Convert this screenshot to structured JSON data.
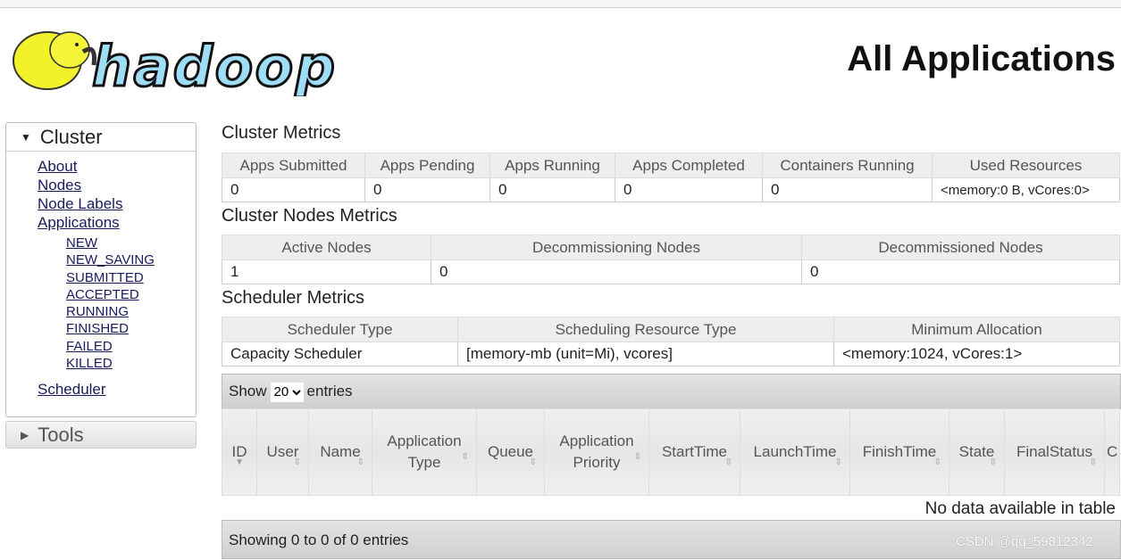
{
  "page_title": "All Applications",
  "sidebar": {
    "cluster_label": "Cluster",
    "links": [
      "About",
      "Nodes",
      "Node Labels",
      "Applications"
    ],
    "app_states": [
      "NEW",
      "NEW_SAVING",
      "SUBMITTED",
      "ACCEPTED",
      "RUNNING",
      "FINISHED",
      "FAILED",
      "KILLED"
    ],
    "scheduler_label": "Scheduler",
    "tools_label": "Tools"
  },
  "cluster_metrics": {
    "title": "Cluster Metrics",
    "headers": [
      "Apps Submitted",
      "Apps Pending",
      "Apps Running",
      "Apps Completed",
      "Containers Running",
      "Used Resources"
    ],
    "values": [
      "0",
      "0",
      "0",
      "0",
      "0",
      "<memory:0 B, vCores:0>"
    ]
  },
  "nodes_metrics": {
    "title": "Cluster Nodes Metrics",
    "headers": [
      "Active Nodes",
      "Decommissioning Nodes",
      "Decommissioned Nodes"
    ],
    "values": [
      "1",
      "0",
      "0"
    ]
  },
  "scheduler_metrics": {
    "title": "Scheduler Metrics",
    "headers": [
      "Scheduler Type",
      "Scheduling Resource Type",
      "Minimum Allocation"
    ],
    "values": [
      "Capacity Scheduler",
      "[memory-mb (unit=Mi), vcores]",
      "<memory:1024, vCores:1>"
    ]
  },
  "apps_table": {
    "show_label": "Show",
    "page_size": "20",
    "entries_label": "entries",
    "columns": [
      "ID",
      "User",
      "Name",
      "Application Type",
      "Queue",
      "Application Priority",
      "StartTime",
      "LaunchTime",
      "FinishTime",
      "State",
      "FinalStatus",
      "C"
    ],
    "empty": "No data available in table",
    "footer": "Showing 0 to 0 of 0 entries"
  },
  "watermark": "CSDN @qq_59812342"
}
